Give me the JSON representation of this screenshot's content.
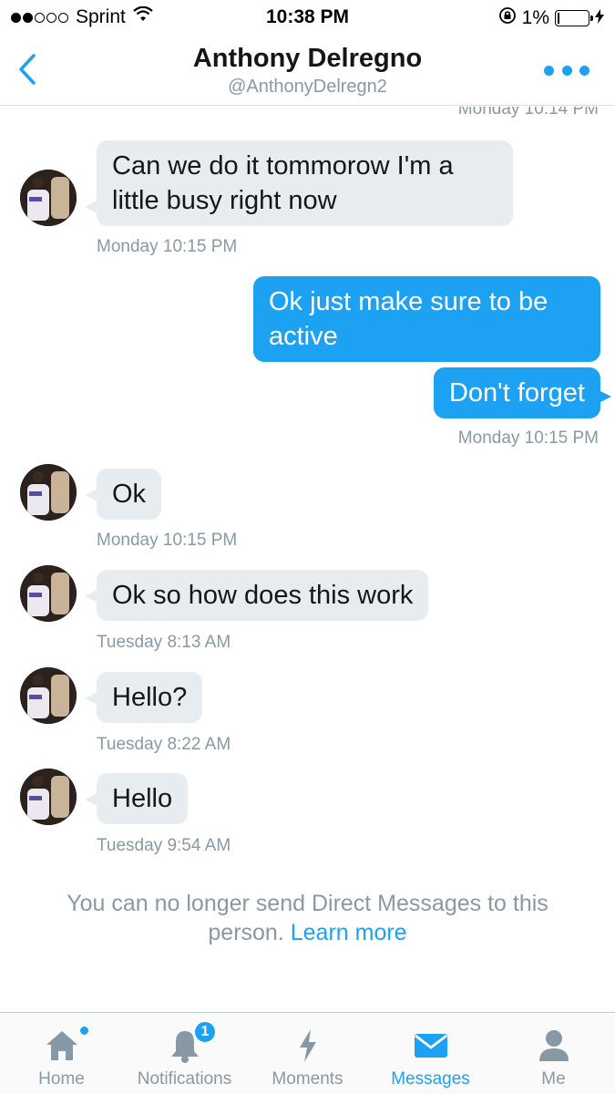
{
  "status_bar": {
    "carrier": "Sprint",
    "time": "10:38 PM",
    "battery": "1%"
  },
  "header": {
    "name": "Anthony Delregno",
    "handle": "@AnthonyDelregn2"
  },
  "messages": {
    "ts_top": "Monday 10:14 PM",
    "m1_text": "Can we do it tommorow I'm a little busy right now",
    "m1_time": "Monday 10:15 PM",
    "m2_text": "Ok just make sure to be active",
    "m3_text": "Don't forget",
    "m3_time": "Monday 10:15 PM",
    "m4_text": "Ok",
    "m4_time": "Monday 10:15 PM",
    "m5_text": "Ok so how does this work",
    "m5_time": "Tuesday 8:13 AM",
    "m6_text": "Hello?",
    "m6_time": "Tuesday 8:22 AM",
    "m7_text": "Hello",
    "m7_time": "Tuesday 9:54 AM"
  },
  "notice": {
    "text": "You can no longer send Direct Messages to this person.",
    "link": "Learn more"
  },
  "tabbar": {
    "home": "Home",
    "notifications": "Notifications",
    "notifications_badge": "1",
    "moments": "Moments",
    "messages": "Messages",
    "me": "Me",
    "active_tab": "Messages"
  },
  "colors": {
    "accent": "#1da1f2",
    "incoming_bubble": "#e6ecf0",
    "muted_text": "#8899a6"
  }
}
